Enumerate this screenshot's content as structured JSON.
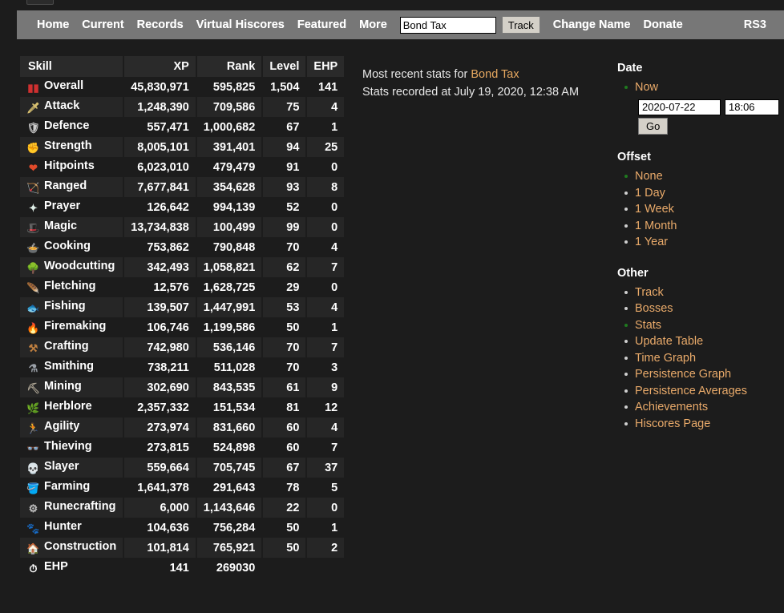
{
  "navbar": {
    "links": [
      {
        "label": "Home",
        "name": "nav-home"
      },
      {
        "label": "Current",
        "name": "nav-current"
      },
      {
        "label": "Records",
        "name": "nav-records"
      },
      {
        "label": "Virtual Hiscores",
        "name": "nav-virtual-hiscores"
      },
      {
        "label": "Featured",
        "name": "nav-featured"
      },
      {
        "label": "More",
        "name": "nav-more"
      }
    ],
    "search_value": "Bond Tax",
    "search_placeholder": "",
    "track_label": "Track",
    "links_after": [
      {
        "label": "Change Name",
        "name": "nav-change-name"
      },
      {
        "label": "Donate",
        "name": "nav-donate"
      }
    ],
    "right_label": "RS3"
  },
  "table": {
    "headers": [
      "Skill",
      "XP",
      "Rank",
      "Level",
      "EHP"
    ],
    "rows": [
      {
        "icon": "overall-icon",
        "skill": "Overall",
        "xp": "45,830,971",
        "rank": "595,825",
        "level": "1,504",
        "ehp": "141"
      },
      {
        "icon": "attack-icon",
        "skill": "Attack",
        "xp": "1,248,390",
        "rank": "709,586",
        "level": "75",
        "ehp": "4"
      },
      {
        "icon": "defence-icon",
        "skill": "Defence",
        "xp": "557,471",
        "rank": "1,000,682",
        "level": "67",
        "ehp": "1"
      },
      {
        "icon": "strength-icon",
        "skill": "Strength",
        "xp": "8,005,101",
        "rank": "391,401",
        "level": "94",
        "ehp": "25"
      },
      {
        "icon": "hitpoints-icon",
        "skill": "Hitpoints",
        "xp": "6,023,010",
        "rank": "479,479",
        "level": "91",
        "ehp": "0"
      },
      {
        "icon": "ranged-icon",
        "skill": "Ranged",
        "xp": "7,677,841",
        "rank": "354,628",
        "level": "93",
        "ehp": "8"
      },
      {
        "icon": "prayer-icon",
        "skill": "Prayer",
        "xp": "126,642",
        "rank": "994,139",
        "level": "52",
        "ehp": "0"
      },
      {
        "icon": "magic-icon",
        "skill": "Magic",
        "xp": "13,734,838",
        "rank": "100,499",
        "level": "99",
        "ehp": "0"
      },
      {
        "icon": "cooking-icon",
        "skill": "Cooking",
        "xp": "753,862",
        "rank": "790,848",
        "level": "70",
        "ehp": "4"
      },
      {
        "icon": "woodcutting-icon",
        "skill": "Woodcutting",
        "xp": "342,493",
        "rank": "1,058,821",
        "level": "62",
        "ehp": "7"
      },
      {
        "icon": "fletching-icon",
        "skill": "Fletching",
        "xp": "12,576",
        "rank": "1,628,725",
        "level": "29",
        "ehp": "0"
      },
      {
        "icon": "fishing-icon",
        "skill": "Fishing",
        "xp": "139,507",
        "rank": "1,447,991",
        "level": "53",
        "ehp": "4"
      },
      {
        "icon": "firemaking-icon",
        "skill": "Firemaking",
        "xp": "106,746",
        "rank": "1,199,586",
        "level": "50",
        "ehp": "1"
      },
      {
        "icon": "crafting-icon",
        "skill": "Crafting",
        "xp": "742,980",
        "rank": "536,146",
        "level": "70",
        "ehp": "7"
      },
      {
        "icon": "smithing-icon",
        "skill": "Smithing",
        "xp": "738,211",
        "rank": "511,028",
        "level": "70",
        "ehp": "3"
      },
      {
        "icon": "mining-icon",
        "skill": "Mining",
        "xp": "302,690",
        "rank": "843,535",
        "level": "61",
        "ehp": "9"
      },
      {
        "icon": "herblore-icon",
        "skill": "Herblore",
        "xp": "2,357,332",
        "rank": "151,534",
        "level": "81",
        "ehp": "12"
      },
      {
        "icon": "agility-icon",
        "skill": "Agility",
        "xp": "273,974",
        "rank": "831,660",
        "level": "60",
        "ehp": "4"
      },
      {
        "icon": "thieving-icon",
        "skill": "Thieving",
        "xp": "273,815",
        "rank": "524,898",
        "level": "60",
        "ehp": "7"
      },
      {
        "icon": "slayer-icon",
        "skill": "Slayer",
        "xp": "559,664",
        "rank": "705,745",
        "level": "67",
        "ehp": "37"
      },
      {
        "icon": "farming-icon",
        "skill": "Farming",
        "xp": "1,641,378",
        "rank": "291,643",
        "level": "78",
        "ehp": "5"
      },
      {
        "icon": "runecrafting-icon",
        "skill": "Runecrafting",
        "xp": "6,000",
        "rank": "1,143,646",
        "level": "22",
        "ehp": "0"
      },
      {
        "icon": "hunter-icon",
        "skill": "Hunter",
        "xp": "104,636",
        "rank": "756,284",
        "level": "50",
        "ehp": "1"
      },
      {
        "icon": "construction-icon",
        "skill": "Construction",
        "xp": "101,814",
        "rank": "765,921",
        "level": "50",
        "ehp": "2"
      },
      {
        "icon": "ehp-icon",
        "skill": "EHP",
        "xp": "141",
        "rank": "269030",
        "level": "",
        "ehp": ""
      }
    ]
  },
  "center": {
    "line1_prefix": "Most recent stats for ",
    "player_name": "Bond Tax",
    "line2": "Stats recorded at July 19, 2020, 12:38 AM"
  },
  "rail": {
    "date": {
      "heading": "Date",
      "now_label": "Now",
      "date_value": "2020-07-22",
      "time_value": "18:06",
      "go_label": "Go"
    },
    "offset": {
      "heading": "Offset",
      "items": [
        {
          "label": "None",
          "active": true
        },
        {
          "label": "1 Day",
          "active": false
        },
        {
          "label": "1 Week",
          "active": false
        },
        {
          "label": "1 Month",
          "active": false
        },
        {
          "label": "1 Year",
          "active": false
        }
      ]
    },
    "other": {
      "heading": "Other",
      "items": [
        {
          "label": "Track",
          "active": false
        },
        {
          "label": "Bosses",
          "active": false
        },
        {
          "label": "Stats",
          "active": true
        },
        {
          "label": "Update Table",
          "active": false
        },
        {
          "label": "Time Graph",
          "active": false
        },
        {
          "label": "Persistence Graph",
          "active": false
        },
        {
          "label": "Persistence Averages",
          "active": false
        },
        {
          "label": "Achievements",
          "active": false
        },
        {
          "label": "Hiscores Page",
          "active": false
        }
      ]
    }
  },
  "colors": {
    "page_bg": "#1c1c1c",
    "navbar_bg": "#777777",
    "link_orange": "#e9aa6a",
    "active_bullet": "#1f7a1f",
    "row_alt_bg": "#262626",
    "header_bg": "#2a2a2a"
  }
}
